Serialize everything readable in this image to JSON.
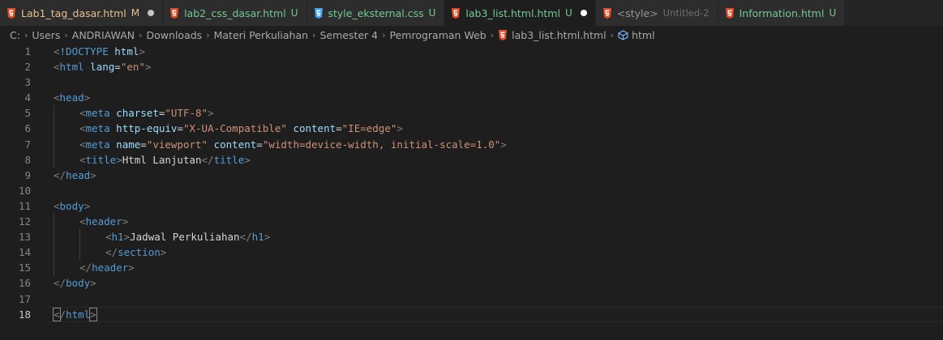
{
  "tabs": [
    {
      "name": "Lab1_tag_dasar.html",
      "status": "M",
      "state": "modified",
      "icon": "html5-icon",
      "dot": true,
      "active": false
    },
    {
      "name": "lab2_css_dasar.html",
      "status": "U",
      "state": "untracked",
      "icon": "html5-icon",
      "dot": false,
      "active": false
    },
    {
      "name": "style_eksternal.css",
      "status": "U",
      "state": "untracked",
      "icon": "css3-icon",
      "dot": false,
      "active": false
    },
    {
      "name": "lab3_list.html.html",
      "status": "U",
      "state": "untracked",
      "icon": "html5-icon",
      "dot": true,
      "active": true
    },
    {
      "name": "<style>",
      "subtitle": "Untitled-2",
      "state": "preview",
      "icon": "html5-icon",
      "dot": false,
      "active": false
    },
    {
      "name": "Information.html",
      "status": "U",
      "state": "untracked",
      "icon": "html5-icon",
      "dot": false,
      "active": false
    }
  ],
  "breadcrumb": {
    "path": [
      "C:",
      "Users",
      "ANDRIAWAN",
      "Downloads",
      "Materi Perkuliahan",
      "Semester 4",
      "Pemrograman Web"
    ],
    "file": "lab3_list.html.html",
    "symbol": "html"
  },
  "editor": {
    "current_line": 18,
    "lines": [
      {
        "n": "1",
        "indent": 0,
        "tokens": [
          [
            "br",
            "<"
          ],
          [
            "tag",
            "!DOCTYPE"
          ],
          [
            "txt",
            " "
          ],
          [
            "attr",
            "html"
          ],
          [
            "br",
            ">"
          ]
        ]
      },
      {
        "n": "2",
        "indent": 0,
        "tokens": [
          [
            "br",
            "<"
          ],
          [
            "tag",
            "html"
          ],
          [
            "txt",
            " "
          ],
          [
            "attr",
            "lang"
          ],
          [
            "txt",
            "="
          ],
          [
            "str",
            "\"en\""
          ],
          [
            "br",
            ">"
          ]
        ]
      },
      {
        "n": "3",
        "indent": 0,
        "tokens": []
      },
      {
        "n": "4",
        "indent": 0,
        "tokens": [
          [
            "br",
            "<"
          ],
          [
            "tag",
            "head"
          ],
          [
            "br",
            ">"
          ]
        ]
      },
      {
        "n": "5",
        "indent": 1,
        "tokens": [
          [
            "br",
            "<"
          ],
          [
            "tag",
            "meta"
          ],
          [
            "txt",
            " "
          ],
          [
            "attr",
            "charset"
          ],
          [
            "txt",
            "="
          ],
          [
            "str",
            "\"UTF-8\""
          ],
          [
            "br",
            ">"
          ]
        ]
      },
      {
        "n": "6",
        "indent": 1,
        "tokens": [
          [
            "br",
            "<"
          ],
          [
            "tag",
            "meta"
          ],
          [
            "txt",
            " "
          ],
          [
            "attr",
            "http-equiv"
          ],
          [
            "txt",
            "="
          ],
          [
            "str",
            "\"X-UA-Compatible\""
          ],
          [
            "txt",
            " "
          ],
          [
            "attr",
            "content"
          ],
          [
            "txt",
            "="
          ],
          [
            "str",
            "\"IE=edge\""
          ],
          [
            "br",
            ">"
          ]
        ]
      },
      {
        "n": "7",
        "indent": 1,
        "tokens": [
          [
            "br",
            "<"
          ],
          [
            "tag",
            "meta"
          ],
          [
            "txt",
            " "
          ],
          [
            "attr",
            "name"
          ],
          [
            "txt",
            "="
          ],
          [
            "str",
            "\"viewport\""
          ],
          [
            "txt",
            " "
          ],
          [
            "attr",
            "content"
          ],
          [
            "txt",
            "="
          ],
          [
            "str",
            "\"width=device-width, initial-scale=1.0\""
          ],
          [
            "br",
            ">"
          ]
        ]
      },
      {
        "n": "8",
        "indent": 1,
        "tokens": [
          [
            "br",
            "<"
          ],
          [
            "tag",
            "title"
          ],
          [
            "br",
            ">"
          ],
          [
            "txt",
            "Html Lanjutan"
          ],
          [
            "br",
            "</"
          ],
          [
            "tag",
            "title"
          ],
          [
            "br",
            ">"
          ]
        ]
      },
      {
        "n": "9",
        "indent": 0,
        "tokens": [
          [
            "br",
            "</"
          ],
          [
            "tag",
            "head"
          ],
          [
            "br",
            ">"
          ]
        ]
      },
      {
        "n": "10",
        "indent": 0,
        "tokens": []
      },
      {
        "n": "11",
        "indent": 0,
        "tokens": [
          [
            "br",
            "<"
          ],
          [
            "tag",
            "body"
          ],
          [
            "br",
            ">"
          ]
        ]
      },
      {
        "n": "12",
        "indent": 1,
        "tokens": [
          [
            "br",
            "<"
          ],
          [
            "tag",
            "header"
          ],
          [
            "br",
            ">"
          ]
        ]
      },
      {
        "n": "13",
        "indent": 2,
        "tokens": [
          [
            "br",
            "<"
          ],
          [
            "tag",
            "h1"
          ],
          [
            "br",
            ">"
          ],
          [
            "txt",
            "Jadwal Perkuliahan"
          ],
          [
            "br",
            "</"
          ],
          [
            "tag",
            "h1"
          ],
          [
            "br",
            ">"
          ]
        ]
      },
      {
        "n": "14",
        "indent": 2,
        "tokens": [
          [
            "br",
            "</"
          ],
          [
            "tag",
            "section"
          ],
          [
            "br",
            ">"
          ]
        ]
      },
      {
        "n": "15",
        "indent": 1,
        "tokens": [
          [
            "br",
            "</"
          ],
          [
            "tag",
            "header"
          ],
          [
            "br",
            ">"
          ]
        ]
      },
      {
        "n": "16",
        "indent": 0,
        "tokens": [
          [
            "br",
            "</"
          ],
          [
            "tag",
            "body"
          ],
          [
            "br",
            ">"
          ]
        ]
      },
      {
        "n": "17",
        "indent": 0,
        "tokens": []
      },
      {
        "n": "18",
        "indent": 0,
        "tokens": [
          [
            "brm",
            "<"
          ],
          [
            "br",
            "/"
          ],
          [
            "tag",
            "html"
          ],
          [
            "brm",
            ">"
          ]
        ]
      }
    ]
  },
  "colors": {
    "tag": "#569cd6",
    "attribute": "#9cdcfe",
    "string": "#ce9178",
    "bracket": "#808080",
    "modified": "#e2c08d",
    "untracked": "#73c991",
    "html_icon": "#e44d26",
    "css_icon": "#42a5f5"
  }
}
